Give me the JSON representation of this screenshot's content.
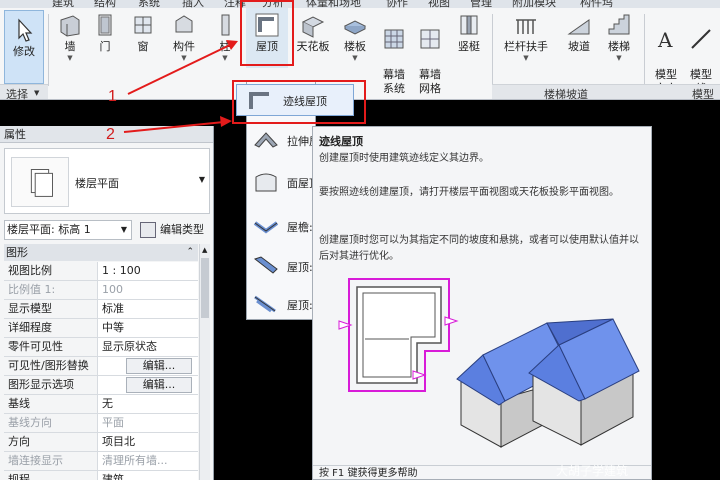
{
  "ribbon": {
    "tabs": [
      "建筑",
      "结构",
      "系统",
      "插入",
      "注释",
      "分析",
      "体量和场地",
      "协作",
      "视图",
      "管理",
      "附加模块",
      "构件坞"
    ],
    "buttons": {
      "modify": "修改",
      "wall": "墙",
      "door": "门",
      "window": "窗",
      "component": "构件",
      "column": "柱",
      "roof": "屋顶",
      "ceiling": "天花板",
      "floor": "楼板",
      "curtain_system": "幕墙\n系统",
      "curtain_grid": "幕墙\n网格",
      "mullion": "竖梃",
      "railing": "栏杆扶手",
      "ramp": "坡道",
      "stair": "楼梯",
      "model_text": "模型\n文字",
      "model_line": "模型\n线"
    },
    "panels": {
      "select": "选择",
      "circulation": "楼梯坡道",
      "model": "模型"
    }
  },
  "roof_dropdown": {
    "highlighted": "迹线屋顶",
    "items": [
      "拉伸屋",
      "面屋顶",
      "屋檐:",
      "屋顶:",
      "屋顶:"
    ]
  },
  "properties": {
    "title": "属性",
    "type_name": "楼层平面",
    "filter": "楼层平面: 标高 1",
    "edit_type": "编辑类型",
    "group": "图形",
    "rows": [
      {
        "name": "视图比例",
        "value": "1 : 100",
        "dim": false
      },
      {
        "name": "比例值 1:",
        "value": "100",
        "dim": true
      },
      {
        "name": "显示模型",
        "value": "标准",
        "dim": false
      },
      {
        "name": "详细程度",
        "value": "中等",
        "dim": false
      },
      {
        "name": "零件可见性",
        "value": "显示原状态",
        "dim": false
      },
      {
        "name": "可见性/图形替换",
        "value": "编辑...",
        "dim": false,
        "button": true
      },
      {
        "name": "图形显示选项",
        "value": "编辑...",
        "dim": false,
        "button": true
      },
      {
        "name": "基线",
        "value": "无",
        "dim": false
      },
      {
        "name": "基线方向",
        "value": "平面",
        "dim": true
      },
      {
        "name": "方向",
        "value": "项目北",
        "dim": false
      },
      {
        "name": "墙连接显示",
        "value": "清理所有墙...",
        "dim": true
      },
      {
        "name": "规程",
        "value": "建筑",
        "dim": false
      }
    ]
  },
  "tooltip": {
    "title": "迹线屋顶",
    "p1": "创建屋顶时使用建筑迹线定义其边界。",
    "p2": "要按照迹线创建屋顶，请打开楼层平面视图或天花板投影平面视图。",
    "p3": "创建屋顶时您可以为其指定不同的坡度和悬挑，或者可以使用默认值并以后对其进行优化。",
    "footer": "按 F1 键获得更多帮助"
  },
  "annotations": {
    "one": "1",
    "two": "2"
  },
  "watermark": "大胡子学建筑",
  "colors": {
    "annotation_red": "#e31b1b",
    "roof_blue": "#5b7fe0",
    "trace_magenta": "#d81bd8"
  }
}
